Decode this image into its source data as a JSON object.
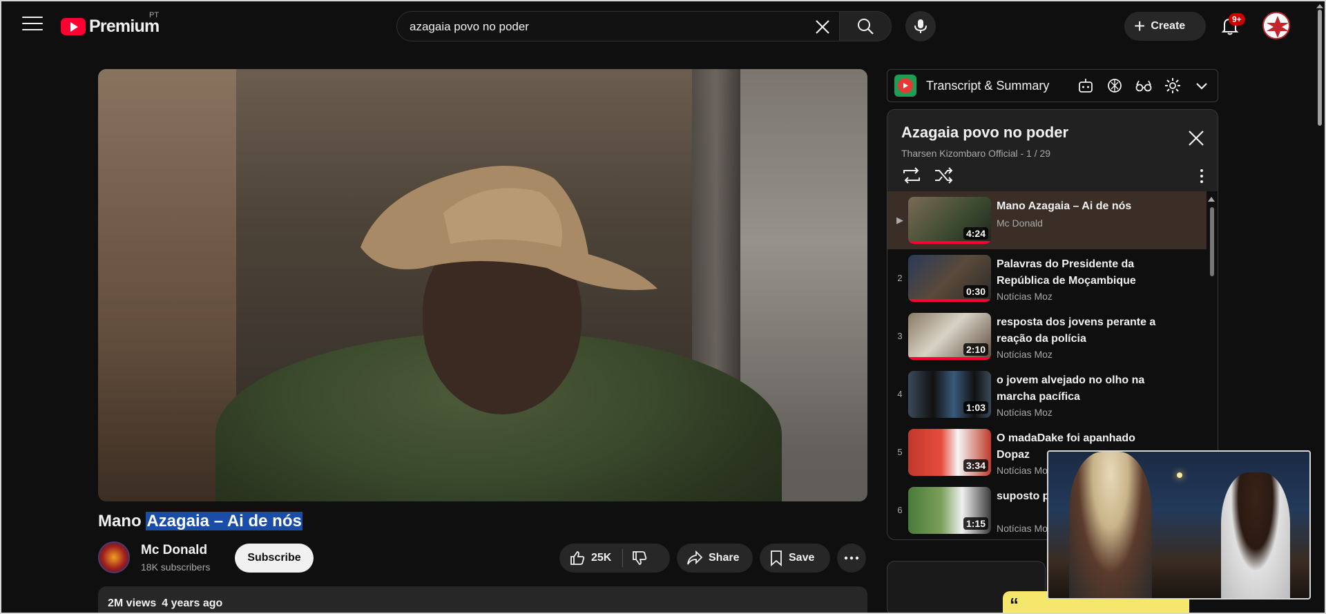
{
  "header": {
    "logo_text": "Premium",
    "country_code": "PT",
    "search_value": "azagaia povo no poder",
    "create_label": "Create",
    "notification_badge": "9+"
  },
  "video": {
    "title_plain": "Mano ",
    "title_highlight": "Azagaia – Ai de nós",
    "channel_name": "Mc Donald",
    "subscribers": "18K subscribers",
    "subscribe_label": "Subscribe",
    "likes": "25K",
    "share_label": "Share",
    "save_label": "Save",
    "views": "2M views",
    "published": "4 years ago"
  },
  "extension": {
    "title": "Transcript & Summary",
    "icons": [
      "robot-icon",
      "openai-icon",
      "glasses-icon",
      "gear-icon",
      "chevron-down-icon"
    ]
  },
  "playlist": {
    "title": "Azagaia povo no poder",
    "subtitle": "Tharsen Kizombaro Official - 1 / 29",
    "items": [
      {
        "index": "▶",
        "title": "Mano Azagaia – Ai de nós",
        "channel": "Mc Donald",
        "duration": "4:24",
        "active": true,
        "progress": 1.0
      },
      {
        "index": "2",
        "title": "Palavras do Presidente da República de Moçambique",
        "channel": "Notícias Moz",
        "duration": "0:30",
        "progress": 1.0
      },
      {
        "index": "3",
        "title": "resposta dos jovens perante a reação da polícia",
        "channel": "Notícias Moz",
        "duration": "2:10",
        "progress": 1.0
      },
      {
        "index": "4",
        "title": "o jovem alvejado no olho na marcha pacífica",
        "channel": "Notícias Moz",
        "duration": "1:03",
        "progress": 0
      },
      {
        "index": "5",
        "title": "O madaDake foi apanhado Dopaz",
        "channel": "Notícias Moz",
        "duration": "3:34",
        "progress": 0
      },
      {
        "index": "6",
        "title": "suposto p... ambulante...",
        "channel": "Notícias Moz",
        "duration": "1:15",
        "progress": 0
      }
    ]
  },
  "colors": {
    "accent": "#ff0033",
    "active_row": "#3a2e26",
    "highlight": "#1a4da8"
  }
}
